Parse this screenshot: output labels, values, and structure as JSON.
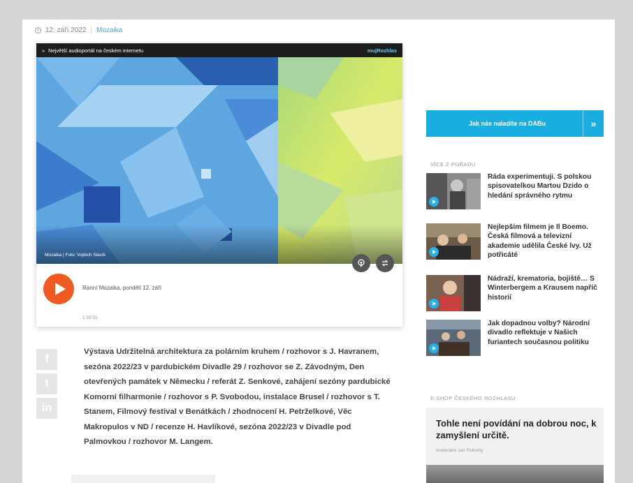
{
  "meta": {
    "date": "12. září 2022",
    "category": "Mozaika"
  },
  "player": {
    "header_title": "Největší audioportál na českém internetu",
    "brand": "mujRozhlas",
    "photo_caption": "Mozaika | Foto: Vojtěch Slavík",
    "episode_title": "Ranní Mozaika, pondělí 12. září",
    "duration": "1:59:55",
    "play_icon": "play-icon",
    "podcast_icon": "podcast-icon",
    "share_icon": "share-icon"
  },
  "social": [
    "f",
    "t",
    "in"
  ],
  "article": {
    "text": "Výstava Udržitelná architektura za polárním kruhem / rozhovor s J. Havranem, sezóna 2022/23 v pardubickém Divadle 29 / rozhovor se Z. Závodným, Den otevřených památek v Německu / referát Z. Senkové, zahájení sezóny pardubické Komorní filharmonie / rozhovor s P. Svobodou, instalace Brusel / rozhovor s T. Stanem, Filmový festival v Benátkách / zhodnocení H. Petrželkové, Věc Makropulos v ND / recenze H. Havlíkové, sezóna 2022/23 v Divadle pod Palmovkou / rozhovor M. Langem."
  },
  "sidebar": {
    "dab_label": "Jak nás naladíte na DABu",
    "dab_arrow": "»",
    "more_heading": "VÍCE Z POŘADU",
    "items": [
      {
        "title": "Ráda experimentuji. S polskou spisovatelkou Martou Dzido o hledání správného rytmu"
      },
      {
        "title": "Nejlepším filmem je Il Boemo. Česká filmová a televizní akademie udělila České lvy. Už potřicáté"
      },
      {
        "title": "Nádraží, krematoria, bojiště… S Winterbergem a Krausem napříč historií"
      },
      {
        "title": "Jak dopadnou volby? Národní divadlo reflektuje v Našich furiantech současnou politiku"
      }
    ],
    "shop_heading": "E-SHOP ČESKÉHO ROZHLASU",
    "shop_title": "Tohle není povídání na dobrou noc, k zamyšlení určitě.",
    "shop_byline": "moderátor Jan Pokorný"
  }
}
